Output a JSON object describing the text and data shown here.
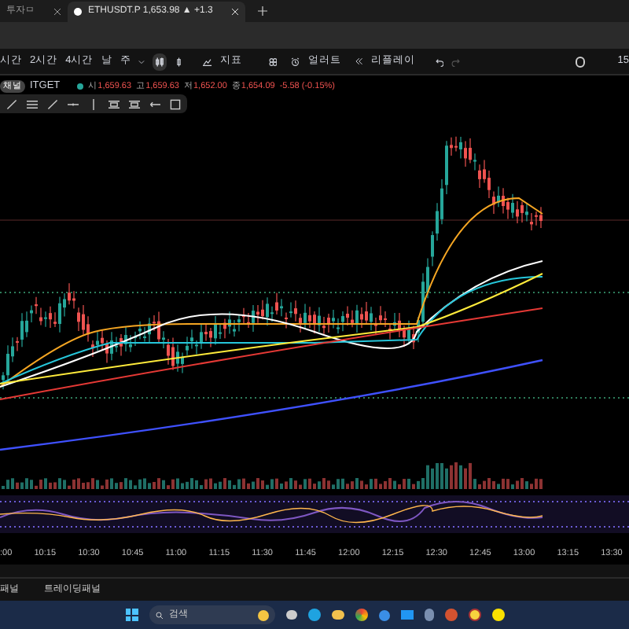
{
  "browser_tabs": [
    {
      "title": "투자ㅁ",
      "selected": false
    },
    {
      "title": "ETHUSDT.P 1,653.98 ▲ +1.3",
      "selected": true
    }
  ],
  "toolbar": {
    "intervals": [
      "시간",
      "2시간",
      "4시간",
      "날",
      "주"
    ],
    "indicators": "지표",
    "alert": "얼러트",
    "replay": "리플레이",
    "right_label": "15"
  },
  "legend": {
    "symbol": "ITGET",
    "tooltip": "채널",
    "values": [
      {
        "key": "시",
        "value": "1,659.63"
      },
      {
        "key": "고",
        "value": "1,659.63"
      },
      {
        "key": "저",
        "value": "1,652.00"
      },
      {
        "key": "종",
        "value": "1,654.09"
      }
    ],
    "change": "-5.58 (-0.15%)"
  },
  "time_axis": [
    ":00",
    "10:15",
    "10:30",
    "10:45",
    "11:00",
    "11:15",
    "11:30",
    "11:45",
    "12:00",
    "12:15",
    "12:30",
    "12:45",
    "13:00",
    "13:15",
    "13:30"
  ],
  "bottom_panels": [
    "패널",
    "트레이딩패널"
  ],
  "taskbar": {
    "search_placeholder": "검색"
  }
}
